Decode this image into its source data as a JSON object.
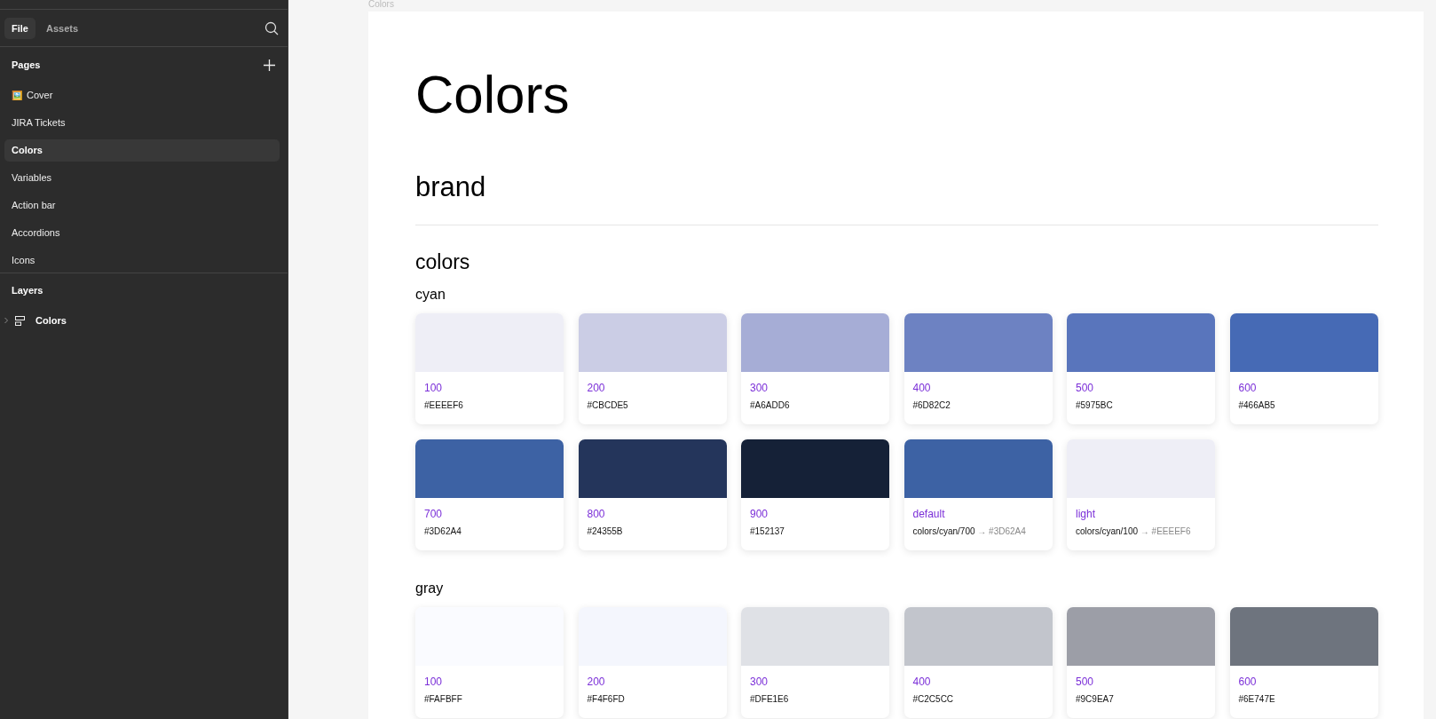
{
  "sidebar": {
    "tabs": [
      {
        "label": "File",
        "selected": true
      },
      {
        "label": "Assets",
        "selected": false
      }
    ],
    "pages_title": "Pages",
    "pages": [
      {
        "label": "Cover",
        "emoji": "🖼️",
        "selected": false
      },
      {
        "label": "JIRA Tickets",
        "selected": false
      },
      {
        "label": "Colors",
        "selected": true
      },
      {
        "label": "Variables",
        "selected": false
      },
      {
        "label": "Action bar",
        "selected": false
      },
      {
        "label": "Accordions",
        "selected": false
      },
      {
        "label": "Icons",
        "selected": false
      }
    ],
    "layers_title": "Layers",
    "layers": [
      {
        "label": "Colors",
        "expanded": false
      }
    ]
  },
  "canvas": {
    "frame_label": "Colors",
    "title": "Colors",
    "section": "brand",
    "subsection": "colors",
    "groups": [
      {
        "name": "cyan",
        "swatches": [
          {
            "kind": "value",
            "name": "100",
            "hex": "#EEEEF6",
            "color": "#eeeef6"
          },
          {
            "kind": "value",
            "name": "200",
            "hex": "#CBCDE5",
            "color": "#cbcde5"
          },
          {
            "kind": "value",
            "name": "300",
            "hex": "#A6ADD6",
            "color": "#a6add6"
          },
          {
            "kind": "value",
            "name": "400",
            "hex": "#6D82C2",
            "color": "#6d82c2"
          },
          {
            "kind": "value",
            "name": "500",
            "hex": "#5975BC",
            "color": "#5975bc"
          },
          {
            "kind": "value",
            "name": "600",
            "hex": "#466AB5",
            "color": "#466ab5"
          },
          {
            "kind": "value",
            "name": "700",
            "hex": "#3D62A4",
            "color": "#3d62a4"
          },
          {
            "kind": "value",
            "name": "800",
            "hex": "#24355B",
            "color": "#24355b"
          },
          {
            "kind": "value",
            "name": "900",
            "hex": "#152137",
            "color": "#152137"
          },
          {
            "kind": "alias",
            "name": "default",
            "ref": "colors/cyan/700",
            "arrow": "→",
            "hex": "#3D62A4",
            "color": "#3d62a4"
          },
          {
            "kind": "alias",
            "name": "light",
            "ref": "colors/cyan/100",
            "arrow": "→",
            "hex": "#EEEEF6",
            "color": "#eeeef6"
          }
        ]
      },
      {
        "name": "gray",
        "swatches": [
          {
            "kind": "value",
            "name": "100",
            "hex": "#FAFBFF",
            "color": "#fafbff"
          },
          {
            "kind": "value",
            "name": "200",
            "hex": "#F4F6FD",
            "color": "#f4f6fd"
          },
          {
            "kind": "value",
            "name": "300",
            "hex": "#DFE1E6",
            "color": "#dfe1e6"
          },
          {
            "kind": "value",
            "name": "400",
            "hex": "#C2C5CC",
            "color": "#c2c5cc"
          },
          {
            "kind": "value",
            "name": "500",
            "hex": "#9C9EA7",
            "color": "#9c9ea7"
          },
          {
            "kind": "value",
            "name": "600",
            "hex": "#6E747E",
            "color": "#6e747e"
          }
        ]
      }
    ]
  }
}
